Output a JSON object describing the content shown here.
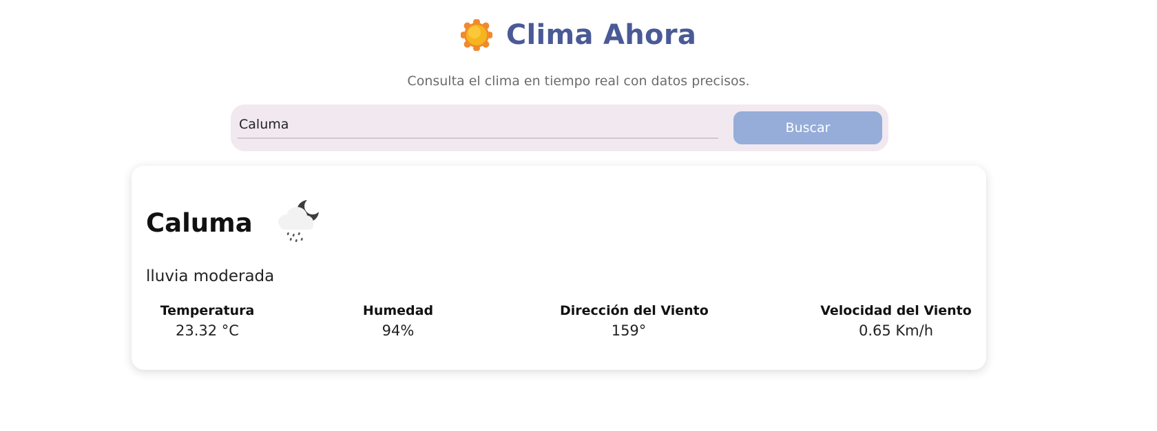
{
  "header": {
    "icon": "sun-icon",
    "title": "Clima Ahora",
    "subtitle": "Consulta el clima en tiempo real con datos precisos.",
    "title_color": "#4a5a96"
  },
  "search": {
    "value": "Caluma",
    "button_label": "Buscar",
    "button_color": "#95add8",
    "bar_color": "#f1e8f0"
  },
  "weather": {
    "city": "Caluma",
    "icon": "rain-night-cloud-icon",
    "condition": "lluvia moderada",
    "metrics": [
      {
        "label": "Temperatura",
        "value": "23.32 °C"
      },
      {
        "label": "Humedad",
        "value": "94%"
      },
      {
        "label": "Dirección del Viento",
        "value": "159°"
      },
      {
        "label": "Velocidad del Viento",
        "value": "0.65 Km/h"
      }
    ]
  }
}
